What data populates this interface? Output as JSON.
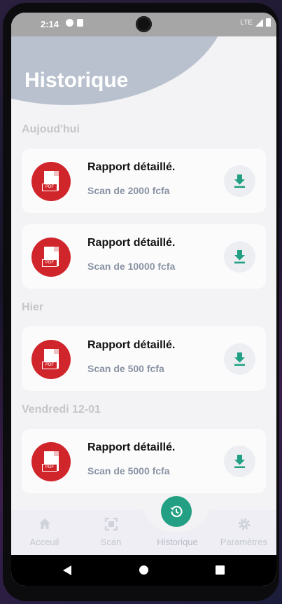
{
  "status_bar": {
    "time": "2:14",
    "network": "LTE"
  },
  "page_title": "Historique",
  "sections": [
    {
      "label": "Aujoud'hui",
      "items": [
        {
          "title": "Rapport détaillé.",
          "subtitle": "Scan de 2000 fcfa",
          "badge": "PDF"
        },
        {
          "title": "Rapport détaillé.",
          "subtitle": "Scan de 10000 fcfa",
          "badge": "PDF"
        }
      ]
    },
    {
      "label": "Hier",
      "items": [
        {
          "title": "Rapport détaillé.",
          "subtitle": "Scan de 500 fcfa",
          "badge": "PDF"
        }
      ]
    },
    {
      "label": "Vendredi 12-01",
      "items": [
        {
          "title": "Rapport détaillé.",
          "subtitle": "Scan de 5000 fcfa",
          "badge": "PDF"
        }
      ]
    }
  ],
  "bottom_nav": [
    {
      "label": "Acceuil",
      "icon": "home-icon"
    },
    {
      "label": "Scan",
      "icon": "scan-icon"
    },
    {
      "label": "Historique",
      "icon": "history-icon",
      "active": true
    },
    {
      "label": "Paramètres",
      "icon": "gear-icon"
    }
  ],
  "colors": {
    "accent": "#23a083",
    "pdf_red": "#d0262b",
    "muted_text": "#8a93a3"
  }
}
